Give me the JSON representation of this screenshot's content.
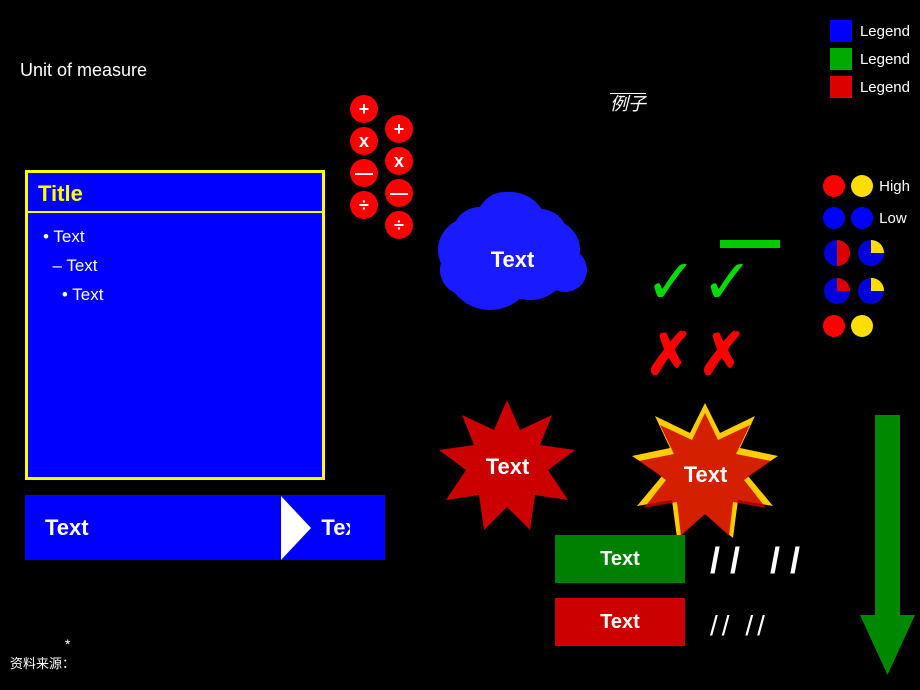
{
  "unit_label": "Unit of measure",
  "legend": {
    "items": [
      {
        "color": "#0000ff",
        "label": "Legend"
      },
      {
        "color": "#00aa00",
        "label": "Legend"
      },
      {
        "color": "#dd0000",
        "label": "Legend"
      }
    ]
  },
  "operators": {
    "col1": [
      "+",
      "x",
      "—",
      "÷"
    ],
    "col2": [
      "+",
      "x",
      "—",
      "÷"
    ]
  },
  "blue_box": {
    "title": "Title",
    "content": [
      "• Text",
      "– Text",
      "  • Text"
    ]
  },
  "arrow_box": {
    "text1": "Text",
    "text2": "Text"
  },
  "rei_label": "例子",
  "cloud_text": "Text",
  "check_marks": "✓✓",
  "x_marks": "✗✗",
  "high_low": {
    "high_label": "High",
    "low_label": "Low"
  },
  "green_text": "Text",
  "red_text": "Text",
  "starburst1_text": "Text",
  "starburst2_text": "Text",
  "source_label": "资料来源：",
  "asterisk": "*"
}
